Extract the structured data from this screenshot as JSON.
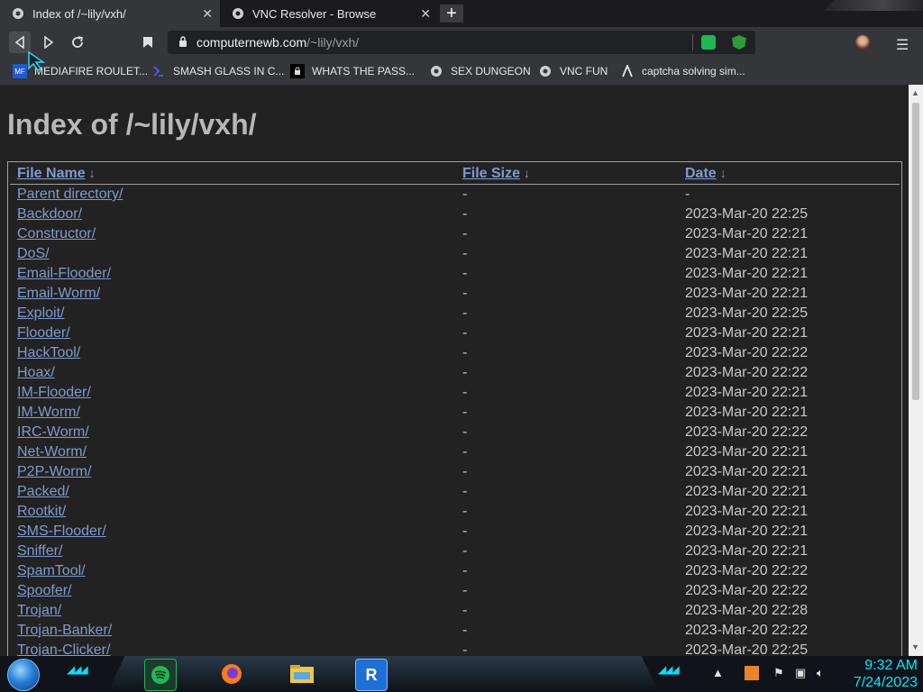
{
  "tabs": [
    {
      "title": "Index of /~lily/vxh/",
      "active": true,
      "icon": "vnc-resolver-icon"
    },
    {
      "title": "VNC Resolver - Browse",
      "active": false,
      "icon": "vnc-resolver-icon"
    }
  ],
  "new_tab_label": "+",
  "address": {
    "host": "computernewb.com",
    "path": "/~lily/vxh/"
  },
  "bookmarks": [
    {
      "label": "MEDIAFIRE ROULET...",
      "icon": "mediafire-icon"
    },
    {
      "label": "SMASH GLASS IN C...",
      "icon": "bracket-icon"
    },
    {
      "label": "WHATS THE PASS...",
      "icon": "lock-icon"
    },
    {
      "label": "SEX DUNGEON",
      "icon": "vnc-resolver-icon"
    },
    {
      "label": "VNC FUN",
      "icon": "vnc-resolver-icon"
    },
    {
      "label": "captcha solving sim...",
      "icon": "lambda-icon"
    }
  ],
  "page": {
    "title": "Index of /~lily/vxh/",
    "columns": [
      {
        "label": "File Name",
        "arrow": "↓"
      },
      {
        "label": "File Size",
        "arrow": "↓"
      },
      {
        "label": "Date",
        "arrow": "↓"
      }
    ],
    "rows": [
      {
        "name": "Parent directory/",
        "size": "-",
        "date": "-"
      },
      {
        "name": "Backdoor/",
        "size": "-",
        "date": "2023-Mar-20 22:25"
      },
      {
        "name": "Constructor/",
        "size": "-",
        "date": "2023-Mar-20 22:21"
      },
      {
        "name": "DoS/",
        "size": "-",
        "date": "2023-Mar-20 22:21"
      },
      {
        "name": "Email-Flooder/",
        "size": "-",
        "date": "2023-Mar-20 22:21"
      },
      {
        "name": "Email-Worm/",
        "size": "-",
        "date": "2023-Mar-20 22:21"
      },
      {
        "name": "Exploit/",
        "size": "-",
        "date": "2023-Mar-20 22:25"
      },
      {
        "name": "Flooder/",
        "size": "-",
        "date": "2023-Mar-20 22:21"
      },
      {
        "name": "HackTool/",
        "size": "-",
        "date": "2023-Mar-20 22:22"
      },
      {
        "name": "Hoax/",
        "size": "-",
        "date": "2023-Mar-20 22:22"
      },
      {
        "name": "IM-Flooder/",
        "size": "-",
        "date": "2023-Mar-20 22:21"
      },
      {
        "name": "IM-Worm/",
        "size": "-",
        "date": "2023-Mar-20 22:21"
      },
      {
        "name": "IRC-Worm/",
        "size": "-",
        "date": "2023-Mar-20 22:22"
      },
      {
        "name": "Net-Worm/",
        "size": "-",
        "date": "2023-Mar-20 22:21"
      },
      {
        "name": "P2P-Worm/",
        "size": "-",
        "date": "2023-Mar-20 22:21"
      },
      {
        "name": "Packed/",
        "size": "-",
        "date": "2023-Mar-20 22:21"
      },
      {
        "name": "Rootkit/",
        "size": "-",
        "date": "2023-Mar-20 22:21"
      },
      {
        "name": "SMS-Flooder/",
        "size": "-",
        "date": "2023-Mar-20 22:21"
      },
      {
        "name": "Sniffer/",
        "size": "-",
        "date": "2023-Mar-20 22:21"
      },
      {
        "name": "SpamTool/",
        "size": "-",
        "date": "2023-Mar-20 22:22"
      },
      {
        "name": "Spoofer/",
        "size": "-",
        "date": "2023-Mar-20 22:22"
      },
      {
        "name": "Trojan/",
        "size": "-",
        "date": "2023-Mar-20 22:28"
      },
      {
        "name": "Trojan-Banker/",
        "size": "-",
        "date": "2023-Mar-20 22:22"
      },
      {
        "name": "Trojan-Clicker/",
        "size": "-",
        "date": "2023-Mar-20 22:25"
      }
    ]
  },
  "taskbar": {
    "apps": [
      "spotify-icon",
      "firefox-icon",
      "file-explorer-icon",
      "vnc-resolver-app-icon"
    ],
    "clock": {
      "time": "9:32 AM",
      "date": "7/24/2023"
    }
  },
  "colors": {
    "link": "#7f9bcf",
    "page_bg": "#222222",
    "clock": "#00e8ff"
  }
}
